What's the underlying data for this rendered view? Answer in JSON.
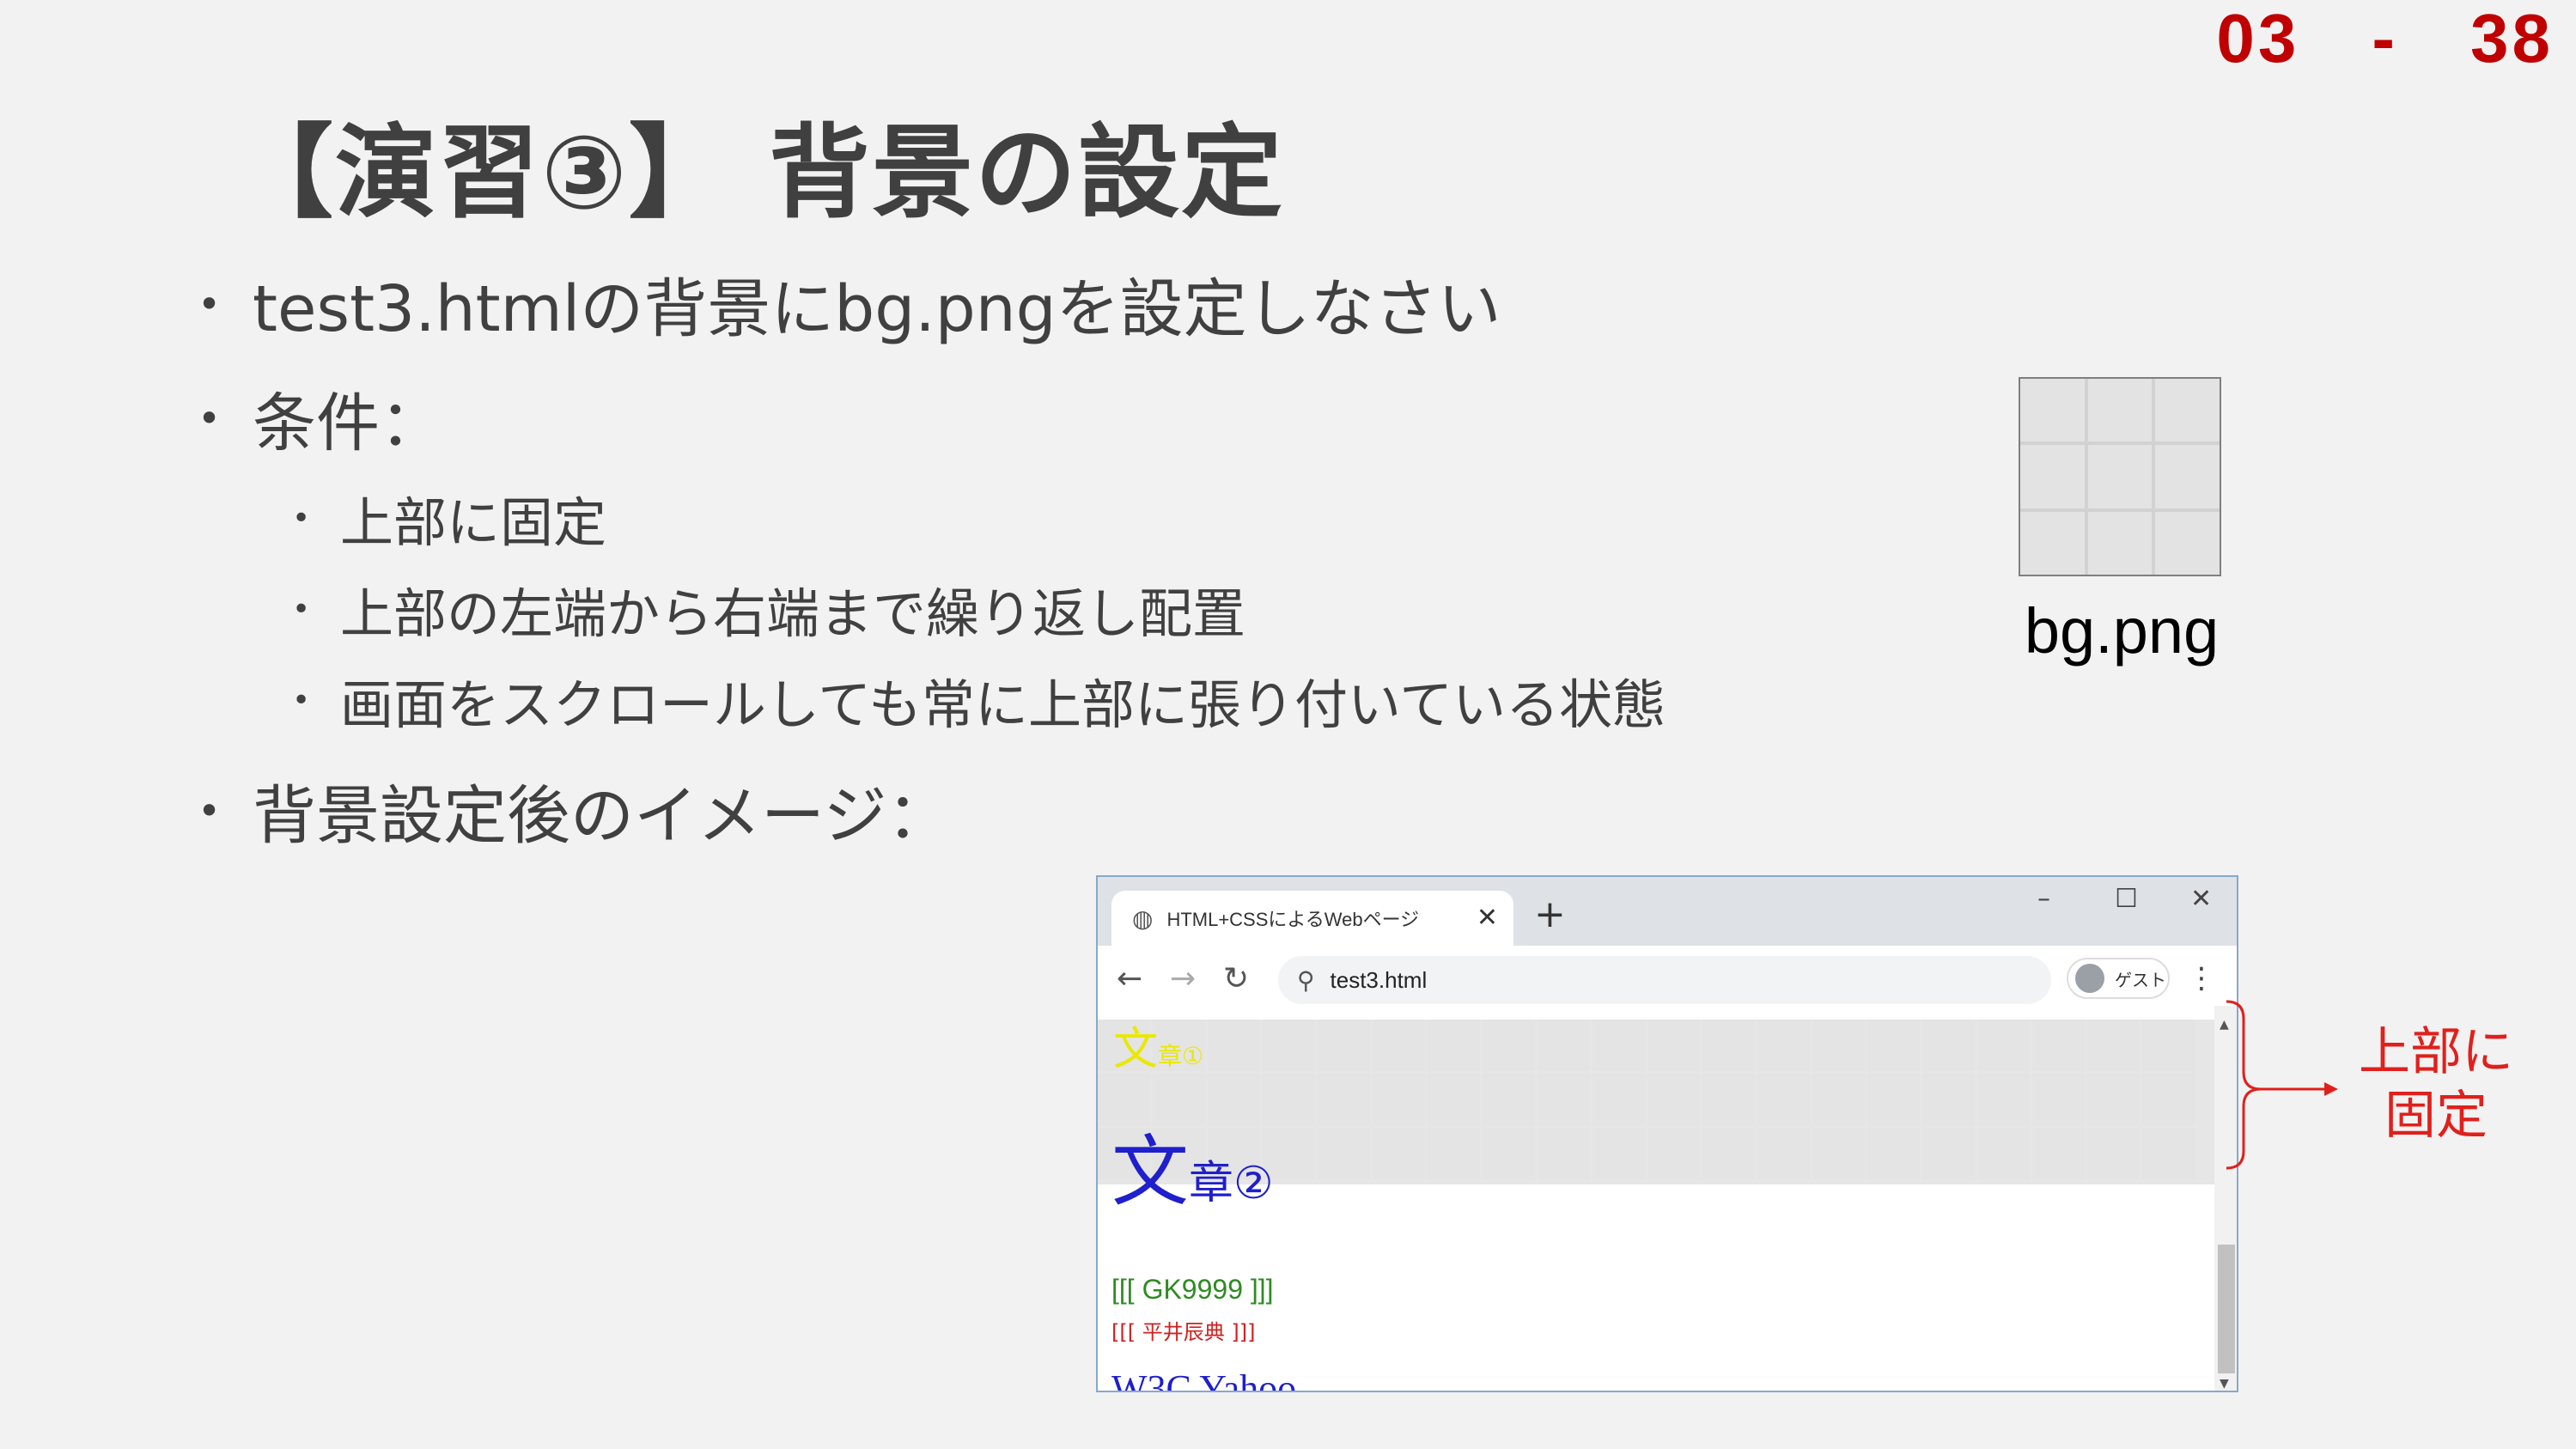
{
  "page_number": "03　-　38",
  "title": "【演習③】 背景の設定",
  "bullets": {
    "b1": "test3.htmlの背景にbg.pngを設定しなさい",
    "b2": "条件：",
    "sub1": "上部に固定",
    "sub2": "上部の左端から右端まで繰り返し配置",
    "sub3": "画面をスクロールしても常に上部に張り付いている状態",
    "b3": "背景設定後のイメージ："
  },
  "bg_image": {
    "caption": "bg.png"
  },
  "browser": {
    "tab_title": "HTML+CSSによるWebページ",
    "url": "test3.html",
    "guest_label": "ゲスト",
    "content": {
      "text1_big": "文",
      "text1_small": "章①",
      "text2_big": "文",
      "text2_small": "章②",
      "text3": "[[[ GK9999 ]]]",
      "text4": "[[[ 平井辰典 ]]]",
      "text5": "W3C Yahoo"
    }
  },
  "annotation": {
    "line1": "上部に",
    "line2": "固定"
  },
  "colors": {
    "accent_red": "#c00000",
    "annotation_red": "#e0201c"
  }
}
